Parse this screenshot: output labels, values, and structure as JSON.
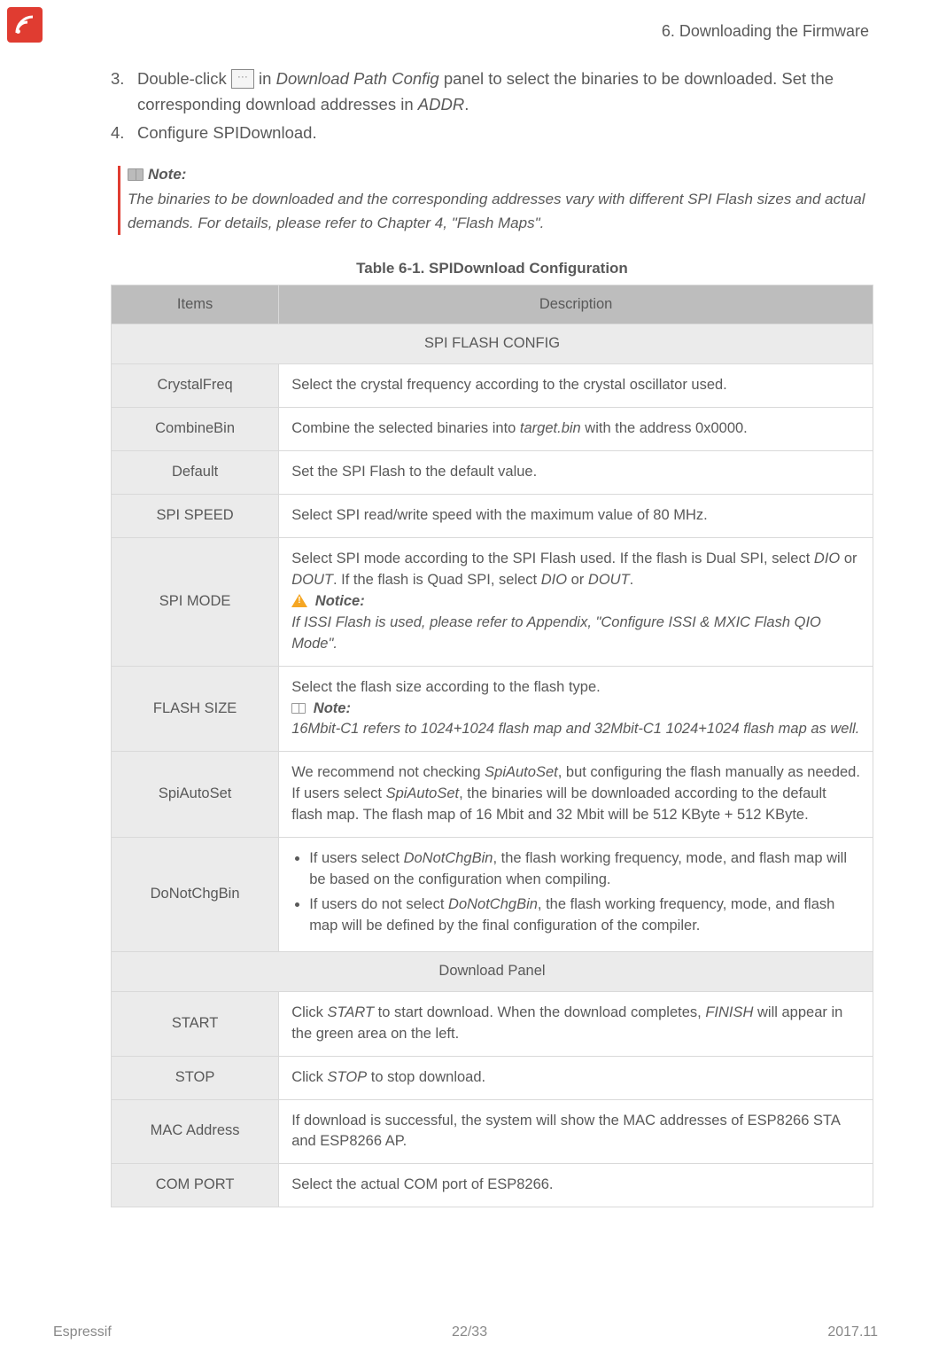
{
  "header": {
    "chapter": "6. Downloading the Firmware"
  },
  "steps": {
    "s3_a": "Double-click ",
    "s3_b": " in ",
    "s3_panel": "Download Path Config",
    "s3_c": " panel to select the binaries to be downloaded. Set the corresponding download addresses in ",
    "s3_addr": "ADDR",
    "s3_d": ".",
    "s4": "Configure SPIDownload."
  },
  "noteBox": {
    "label": "Note:",
    "text": "The binaries to be downloaded and the corresponding addresses vary with different SPI Flash sizes and actual demands. For details, please refer to Chapter 4, \"Flash Maps\"."
  },
  "table": {
    "caption": "Table 6-1. SPIDownload Configuration",
    "head_items": "Items",
    "head_desc": "Description",
    "section1": "SPI FLASH CONFIG",
    "section2": "Download Panel",
    "r1_item": "CrystalFreq",
    "r1_desc": "Select the crystal frequency according to the crystal oscillator used.",
    "r2_item": "CombineBin",
    "r2_desc_a": "Combine the selected binaries into ",
    "r2_desc_b": "target.bin",
    "r2_desc_c": " with the address 0x0000.",
    "r3_item": "Default",
    "r3_desc": "Set the SPI Flash to the default value.",
    "r4_item": "SPI SPEED",
    "r4_desc": "Select SPI read/write speed with the maximum value of 80 MHz.",
    "r5_item": "SPI MODE",
    "r5_desc_a": "Select SPI mode according to the SPI Flash used. If the flash is Dual SPI, select ",
    "r5_dio": "DIO",
    "r5_or": " or ",
    "r5_dout": "DOUT",
    "r5_desc_b": ". If the flash is Quad SPI, select ",
    "r5_desc_c": ".",
    "r5_notice_label": "Notice:",
    "r5_notice_body": "If ISSI Flash is used, please refer to Appendix, \"Configure ISSI & MXIC Flash QIO Mode\".",
    "r6_item": "FLASH SIZE",
    "r6_desc_a": "Select the flash size according to the flash type.",
    "r6_note_label": "Note:",
    "r6_note_b1": "16Mbit-C1",
    "r6_note_t1": " refers to 1024+1024 flash map and ",
    "r6_note_b2": "32Mbit-C1",
    "r6_note_t2": " 1024+1024 flash map as well.",
    "r7_item": "SpiAutoSet",
    "r7_desc_a": "We recommend not checking ",
    "r7_sas": "SpiAutoSet",
    "r7_desc_b": ", but configuring the flash manually as needed.",
    "r7_desc_c": "If users select ",
    "r7_desc_d": ", the binaries will be downloaded according to the default flash map. The flash map of 16 Mbit and 32 Mbit will be 512 KByte + 512 KByte.",
    "r8_item": "DoNotChgBin",
    "r8_l1_a": "If users select ",
    "r8_dnb": "DoNotChgBin",
    "r8_l1_b": ", the flash working frequency, mode, and flash map will be based on the configuration when compiling.",
    "r8_l2_a": "If users do not select ",
    "r8_l2_b": ", the flash working frequency, mode, and flash map will be defined by the final configuration of the compiler.",
    "r9_item": "START",
    "r9_a": "Click ",
    "r9_start": "START",
    "r9_b": " to start download. When the download completes, ",
    "r9_finish": "FINISH",
    "r9_c": " will appear in the green area on the left.",
    "r10_item": "STOP",
    "r10_a": "Click ",
    "r10_stop": "STOP",
    "r10_b": " to stop download.",
    "r11_item": "MAC Address",
    "r11_desc": "If download is successful, the system will show the MAC addresses of ESP8266 STA and ESP8266 AP.",
    "r12_item": "COM PORT",
    "r12_desc": "Select the actual COM port of ESP8266."
  },
  "footer": {
    "left": "Espressif",
    "center": "22/33",
    "right": "2017.11"
  }
}
